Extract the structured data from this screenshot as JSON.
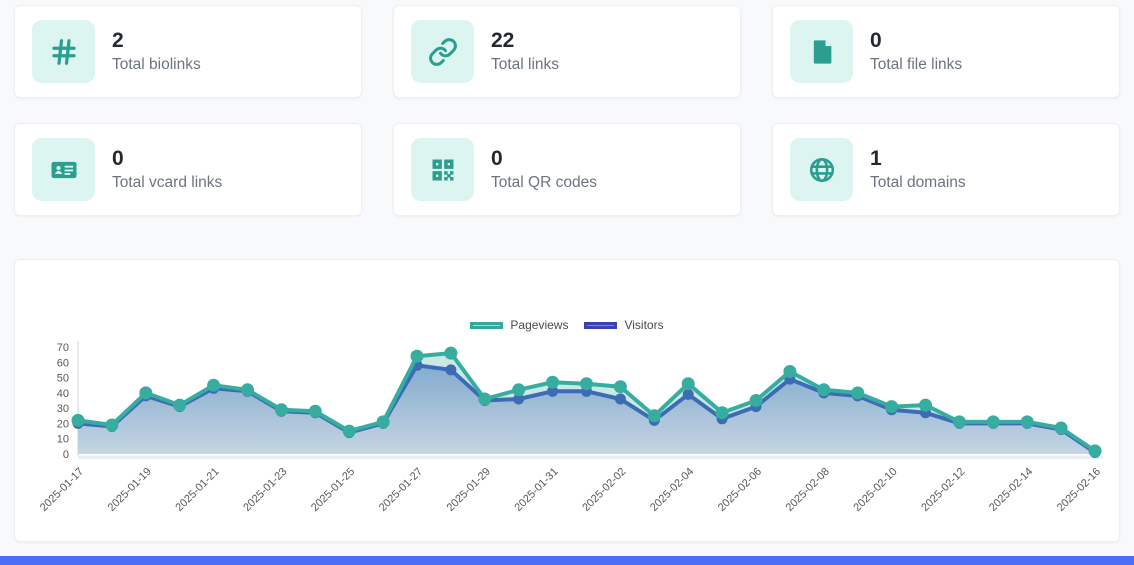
{
  "stats": [
    {
      "icon": "hash-icon",
      "value": "2",
      "label": "Total biolinks"
    },
    {
      "icon": "link-icon",
      "value": "22",
      "label": "Total links"
    },
    {
      "icon": "file-icon",
      "value": "0",
      "label": "Total file links"
    },
    {
      "icon": "vcard-icon",
      "value": "0",
      "label": "Total vcard links"
    },
    {
      "icon": "qr-code-icon",
      "value": "0",
      "label": "Total QR codes"
    },
    {
      "icon": "globe-icon",
      "value": "1",
      "label": "Total domains"
    }
  ],
  "chart_data": {
    "type": "line",
    "x": [
      "2025-01-17",
      "2025-01-18",
      "2025-01-19",
      "2025-01-20",
      "2025-01-21",
      "2025-01-22",
      "2025-01-23",
      "2025-01-24",
      "2025-01-25",
      "2025-01-26",
      "2025-01-27",
      "2025-01-28",
      "2025-01-29",
      "2025-01-30",
      "2025-01-31",
      "2025-02-01",
      "2025-02-02",
      "2025-02-03",
      "2025-02-04",
      "2025-02-05",
      "2025-02-06",
      "2025-02-07",
      "2025-02-08",
      "2025-02-09",
      "2025-02-10",
      "2025-02-11",
      "2025-02-12",
      "2025-02-13",
      "2025-02-14",
      "2025-02-15",
      "2025-02-16"
    ],
    "series": [
      {
        "name": "Pageviews",
        "values": [
          22,
          19,
          40,
          32,
          45,
          42,
          29,
          28,
          15,
          21,
          64,
          66,
          36,
          42,
          47,
          46,
          44,
          25,
          46,
          27,
          35,
          54,
          42,
          40,
          31,
          32,
          21,
          21,
          21,
          17,
          2
        ]
      },
      {
        "name": "Visitors",
        "values": [
          20,
          18,
          38,
          31,
          43,
          41,
          28,
          27,
          14,
          20,
          58,
          55,
          35,
          36,
          41,
          41,
          36,
          22,
          39,
          23,
          31,
          49,
          40,
          38,
          29,
          27,
          20,
          20,
          20,
          16,
          1
        ]
      }
    ],
    "ylim": [
      0,
      70
    ],
    "yticks": [
      0,
      10,
      20,
      30,
      40,
      50,
      60,
      70
    ],
    "x_tick_every": 2,
    "grid": false,
    "legend_position": "top"
  },
  "colors": {
    "page_bg": "#f8f9fa",
    "card_bg": "#ffffff",
    "tile_bg": "#ddf5f0",
    "accent_teal": "#2b9e90",
    "value_text": "#24292e",
    "label_text": "#6b7480",
    "pageviews_line": "#36ad9e",
    "pageviews_fill": "#c9e9e2",
    "visitors_line": "#3b6cb5",
    "visitors_fill_top": "#84abce",
    "visitors_fill_bottom": "#c5d5e2",
    "legend_pageviews_fill": "#a6d9d0",
    "legend_pageviews_border": "#36a89a",
    "legend_visitors_fill": "#7e85d6",
    "legend_visitors_border": "#3a41b5",
    "axis_text": "#595959",
    "axis_line": "#dfe3e8",
    "baseline_band": "#e7edf4",
    "footer_bar": "#4a6df5"
  }
}
